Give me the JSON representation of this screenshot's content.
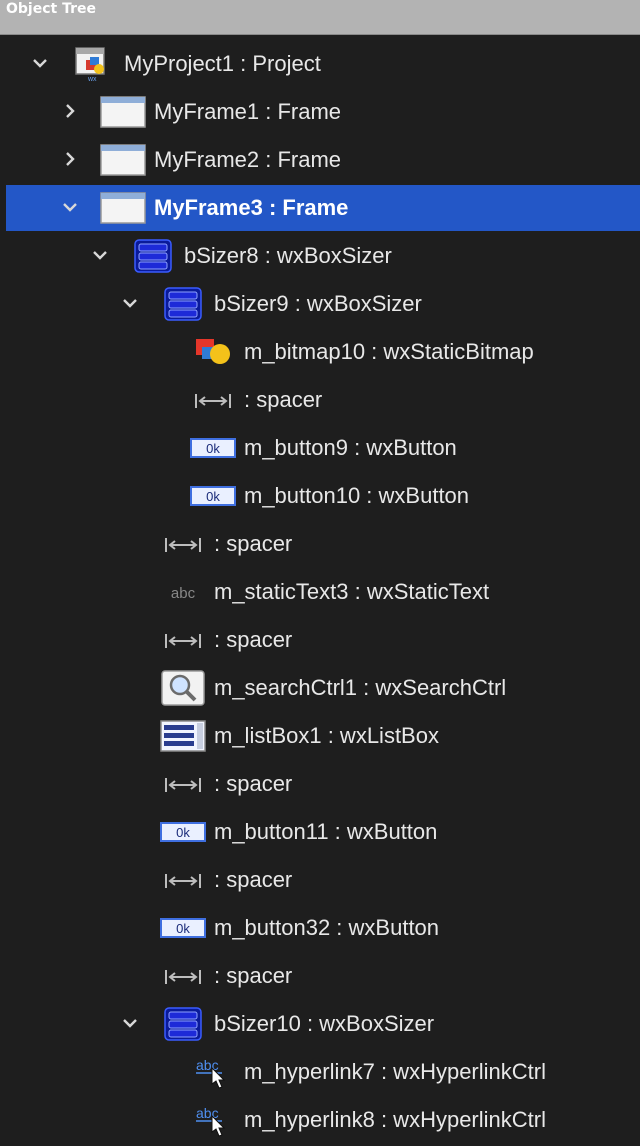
{
  "panel": {
    "title": "Object Tree"
  },
  "tree": [
    {
      "label": "MyProject1 : Project",
      "icon": "project-icon",
      "depth": 0,
      "expander": "expanded"
    },
    {
      "label": "MyFrame1 : Frame",
      "icon": "frame-icon",
      "depth": 1,
      "expander": "collapsed"
    },
    {
      "label": "MyFrame2 : Frame",
      "icon": "frame-icon",
      "depth": 1,
      "expander": "collapsed"
    },
    {
      "label": "MyFrame3 : Frame",
      "icon": "frame-icon",
      "depth": 1,
      "expander": "expanded",
      "selected": true
    },
    {
      "label": "bSizer8 : wxBoxSizer",
      "icon": "box-sizer-icon",
      "depth": 2,
      "expander": "expanded"
    },
    {
      "label": "bSizer9 : wxBoxSizer",
      "icon": "box-sizer-icon",
      "depth": 3,
      "expander": "expanded"
    },
    {
      "label": "m_bitmap10 : wxStaticBitmap",
      "icon": "static-bitmap-icon",
      "depth": 4
    },
    {
      "label": ": spacer",
      "icon": "spacer-icon",
      "depth": 4
    },
    {
      "label": "m_button9 : wxButton",
      "icon": "button-icon",
      "depth": 4
    },
    {
      "label": "m_button10 : wxButton",
      "icon": "button-icon",
      "depth": 4
    },
    {
      "label": ": spacer",
      "icon": "spacer-icon",
      "depth": 3
    },
    {
      "label": "m_staticText3 : wxStaticText",
      "icon": "static-text-icon",
      "depth": 3
    },
    {
      "label": ": spacer",
      "icon": "spacer-icon",
      "depth": 3
    },
    {
      "label": "m_searchCtrl1 : wxSearchCtrl",
      "icon": "search-ctrl-icon",
      "depth": 3
    },
    {
      "label": "m_listBox1 : wxListBox",
      "icon": "list-box-icon",
      "depth": 3
    },
    {
      "label": ": spacer",
      "icon": "spacer-icon",
      "depth": 3
    },
    {
      "label": "m_button11 : wxButton",
      "icon": "button-icon",
      "depth": 3
    },
    {
      "label": ": spacer",
      "icon": "spacer-icon",
      "depth": 3
    },
    {
      "label": "m_button32 : wxButton",
      "icon": "button-icon",
      "depth": 3
    },
    {
      "label": ": spacer",
      "icon": "spacer-icon",
      "depth": 3
    },
    {
      "label": "bSizer10 : wxBoxSizer",
      "icon": "box-sizer-icon",
      "depth": 3,
      "expander": "expanded"
    },
    {
      "label": "m_hyperlink7 : wxHyperlinkCtrl",
      "icon": "hyperlink-icon",
      "depth": 4
    },
    {
      "label": "m_hyperlink8 : wxHyperlinkCtrl",
      "icon": "hyperlink-icon",
      "depth": 4
    }
  ],
  "colors": {
    "selection": "#2357c7",
    "background": "#1e1e1e",
    "text": "#e8e8e8"
  }
}
